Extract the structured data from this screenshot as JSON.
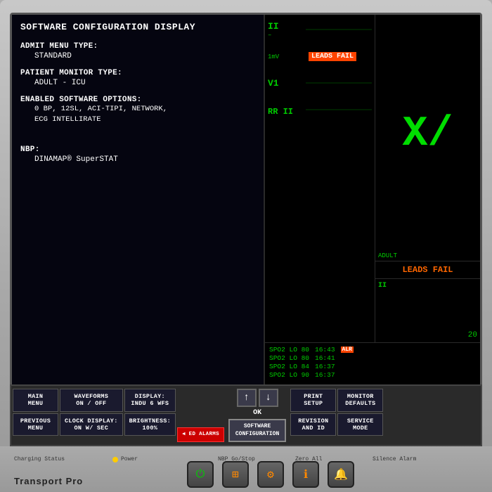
{
  "device": {
    "model": "Transport Pro",
    "screen_id": "ED-48"
  },
  "config_display": {
    "title": "SOFTWARE CONFIGURATION DISPLAY",
    "admit_menu_type_label": "ADMIT MENU TYPE:",
    "admit_menu_type_value": "STANDARD",
    "patient_monitor_type_label": "PATIENT MONITOR TYPE:",
    "patient_monitor_type_value": "ADULT - ICU",
    "enabled_options_label": "ENABLED SOFTWARE OPTIONS:",
    "enabled_options_value": "0 BP, 12SL, ACI-TIPI, NETWORK,",
    "enabled_options_value2": "ECG INTELLIRATE",
    "nbp_label": "NBP:",
    "nbp_value": "DINAMAP® SuperSTAT"
  },
  "waveforms": {
    "channel1_label": "II",
    "channel1_sub": "–",
    "channel2_label": "1mV",
    "channel2_leads_fail": "LEADS FAIL",
    "channel3_label": "V1",
    "channel4_label": "RR II"
  },
  "mini_display": {
    "adult_label": "ADULT",
    "leads_fail": "LEADS FAIL",
    "ii_label": "II"
  },
  "spo2": {
    "readings": [
      {
        "label": "SPO2 LO 80",
        "time": "16:43",
        "alr": true
      },
      {
        "label": "SPO2 LO 80",
        "time": "16:41",
        "alr": false
      },
      {
        "label": "SPO2 LO 84",
        "time": "16:37",
        "alr": false
      },
      {
        "label": "SPO2 LO 90",
        "time": "16:37",
        "alr": false
      }
    ]
  },
  "buttons": {
    "row1": [
      {
        "id": "main-menu",
        "label": "MAIN\nMENU"
      },
      {
        "id": "waveforms",
        "label": "WAVEFORMS\nON / OFF"
      },
      {
        "id": "display",
        "label": "DISPLAY:\nINDU 6 WFS"
      },
      {
        "id": "print-setup",
        "label": "PRINT\nSETUP"
      },
      {
        "id": "monitor-defaults",
        "label": "MONITOR\nDEFAULTS"
      }
    ],
    "row2": [
      {
        "id": "previous-menu",
        "label": "PREVIOUS\nMENU"
      },
      {
        "id": "clock-display",
        "label": "CLOCK DISPLAY:\nON W/ SEC"
      },
      {
        "id": "brightness",
        "label": "BRIGHTNESS:\n100%"
      },
      {
        "id": "revision-id",
        "label": "REVISION\nAND ID"
      },
      {
        "id": "service-mode",
        "label": "SERVICE\nMODE"
      }
    ],
    "center_up": "↑",
    "center_down": "↓",
    "ok_label": "OK",
    "software_config": "SOFTWARE\nCONFIGURATION",
    "ed_alarms": "◀ ED ALARMS"
  },
  "bottom_bar": {
    "charging_status": "Charging Status",
    "power": "Power",
    "nbp_go_stop": "NBP Go/Stop",
    "zero_all": "Zero All",
    "silence_alarm": "Silence Alarm"
  },
  "colors": {
    "green": "#00cc00",
    "orange": "#ff6600",
    "red": "#ff4400",
    "screen_bg": "#000000",
    "config_bg": "#050510",
    "bezel": "#b0b0b0"
  }
}
